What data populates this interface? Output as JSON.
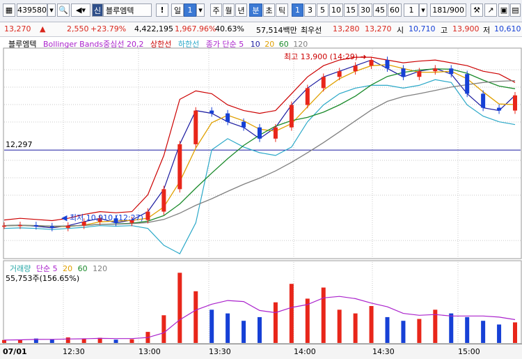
{
  "toolbar": {
    "code": "439580",
    "stock_badge": "신",
    "stock_name": "블루엠텍",
    "alert": "!",
    "period_selected": "일",
    "period_num": "1",
    "periods": [
      "주",
      "월",
      "년",
      "분",
      "초",
      "틱"
    ],
    "period_active": "분",
    "intervals": [
      "1",
      "3",
      "5",
      "10",
      "15",
      "30",
      "45",
      "60"
    ],
    "interval_active": "1",
    "count_select": "1",
    "page_current": "181",
    "page_total": "/900"
  },
  "quote": {
    "price": "13,270",
    "change_arrow": "▲",
    "change": "2,550",
    "change_pct": "+23.79%",
    "volume": "4,422,195",
    "volume_ratio": "1,967.96%",
    "turnover_ratio": "40.63%",
    "amount": "57,514백만",
    "best_ask_label": "최우선",
    "best_ask": "13,280",
    "best_bid": "13,270",
    "open_label": "시",
    "open": "10,710",
    "high_label": "고",
    "high": "13,900",
    "low_label": "저",
    "low": "10,610"
  },
  "price_legend": {
    "name": "블루엠텍",
    "bollinger": "Bollinger Bands중심선 20,2",
    "upper": "상한선",
    "lower": "하한선",
    "ma_label": "종가 단순 5",
    "ma10": "10",
    "ma20": "20",
    "ma60": "60",
    "ma120": "120"
  },
  "annotations": {
    "high": "최고 13,900 (14:29)",
    "low": "최저 10,910 (12:27)",
    "prev_close": "12,297"
  },
  "volume_legend": {
    "name": "거래량",
    "ma_label": "단순 5",
    "ma20": "20",
    "ma60": "60",
    "ma120": "120",
    "value": "55,753주(156.65%)"
  },
  "axis": {
    "date": "07/01",
    "ticks": [
      "12:30",
      "13:00",
      "13:30",
      "14:00",
      "14:30",
      "15:00"
    ]
  },
  "colors": {
    "up": "#e8261a",
    "down": "#1640d6",
    "bollinger": "#cc0000",
    "band_lower": "#2aa8c8",
    "ma5": "#1a1aa0",
    "ma20": "#e0a000",
    "ma60": "#1a8a2a",
    "ma120": "#808080"
  },
  "chart_data": {
    "type": "line",
    "title": "블루엠텍",
    "x": [
      "12:00",
      "12:10",
      "12:20",
      "12:27",
      "12:30",
      "12:40",
      "12:50",
      "13:00",
      "13:10",
      "13:20",
      "13:25",
      "13:30",
      "13:35",
      "13:40",
      "13:45",
      "13:50",
      "13:55",
      "14:00",
      "14:05",
      "14:10",
      "14:15",
      "14:20",
      "14:25",
      "14:29",
      "14:35",
      "14:40",
      "14:45",
      "14:50",
      "14:55",
      "15:00",
      "15:05",
      "15:10",
      "15:15"
    ],
    "series": [
      {
        "name": "종가",
        "values": [
          10950,
          10960,
          10940,
          10910,
          10950,
          11020,
          11080,
          11000,
          11050,
          11200,
          11600,
          12400,
          13000,
          12950,
          12800,
          12700,
          12500,
          12700,
          13100,
          13400,
          13600,
          13700,
          13800,
          13900,
          13750,
          13600,
          13700,
          13750,
          13650,
          13300,
          13050,
          13000,
          13270
        ]
      },
      {
        "name": "상한선",
        "values": [
          11050,
          11080,
          11060,
          11040,
          11080,
          11150,
          11200,
          11180,
          11200,
          11500,
          12200,
          13200,
          13350,
          13300,
          13100,
          13000,
          12950,
          13000,
          13300,
          13600,
          13800,
          13900,
          13950,
          13950,
          13900,
          13850,
          13880,
          13900,
          13850,
          13800,
          13700,
          13650,
          13500
        ]
      },
      {
        "name": "하한선",
        "values": [
          10900,
          10910,
          10900,
          10880,
          10900,
          10920,
          10950,
          10940,
          10950,
          10900,
          10600,
          10450,
          11000,
          12300,
          12500,
          12350,
          12250,
          12200,
          12350,
          12800,
          13100,
          13300,
          13400,
          13450,
          13450,
          13400,
          13450,
          13550,
          13500,
          13100,
          12900,
          12800,
          12750
        ]
      }
    ],
    "ylim": [
      10400,
      14100
    ],
    "prev_close_line": 12297,
    "annotations": [
      "최고 13,900 (14:29)",
      "최저 10,910 (12:27)"
    ]
  },
  "volume_chart": {
    "type": "bar",
    "name": "거래량",
    "values": [
      8000,
      9000,
      12000,
      10000,
      15000,
      11000,
      14000,
      9000,
      10000,
      30000,
      75000,
      190000,
      140000,
      90000,
      80000,
      60000,
      70000,
      110000,
      160000,
      120000,
      150000,
      90000,
      80000,
      100000,
      70000,
      60000,
      65000,
      90000,
      80000,
      70000,
      60000,
      50000,
      55753
    ]
  }
}
